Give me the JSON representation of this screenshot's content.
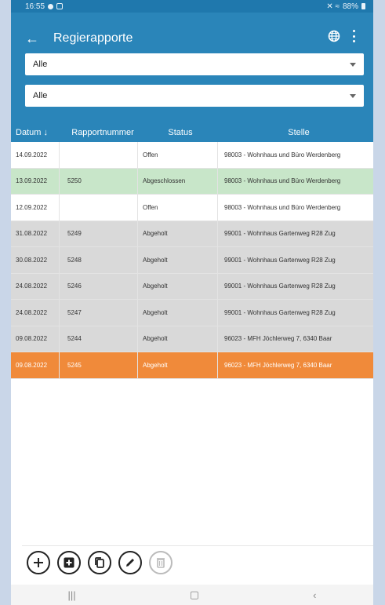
{
  "status_bar": {
    "time": "16:55",
    "battery": "88%"
  },
  "app_bar": {
    "title": "Regierapporte",
    "back_icon": "arrow-left-icon",
    "globe_icon": "globe-icon",
    "menu_icon": "more-vert-icon"
  },
  "filters": [
    {
      "value": "Alle"
    },
    {
      "value": "Alle"
    }
  ],
  "table": {
    "headers": {
      "date": "Datum ↓",
      "number": "Rapportnummer",
      "status": "Status",
      "stelle": "Stelle"
    },
    "rows": [
      {
        "date": "14.09.2022",
        "number": "",
        "status": "Offen",
        "stelle": "98003 - Wohnhaus und Büro Werdenberg",
        "color": "white"
      },
      {
        "date": "13.09.2022",
        "number": "5250",
        "status": "Abgeschlossen",
        "stelle": "98003 - Wohnhaus und Büro Werdenberg",
        "color": "green"
      },
      {
        "date": "12.09.2022",
        "number": "",
        "status": "Offen",
        "stelle": "98003 - Wohnhaus und Büro Werdenberg",
        "color": "white"
      },
      {
        "date": "31.08.2022",
        "number": "5249",
        "status": "Abgeholt",
        "stelle": "99001 - Wohnhaus Gartenweg R28 Zug",
        "color": "grey"
      },
      {
        "date": "30.08.2022",
        "number": "5248",
        "status": "Abgeholt",
        "stelle": "99001 - Wohnhaus Gartenweg R28 Zug",
        "color": "grey"
      },
      {
        "date": "24.08.2022",
        "number": "5246",
        "status": "Abgeholt",
        "stelle": "99001 - Wohnhaus Gartenweg R28 Zug",
        "color": "grey"
      },
      {
        "date": "24.08.2022",
        "number": "5247",
        "status": "Abgeholt",
        "stelle": "99001 - Wohnhaus Gartenweg R28 Zug",
        "color": "grey"
      },
      {
        "date": "09.08.2022",
        "number": "5244",
        "status": "Abgeholt",
        "stelle": "96023 - MFH Jöchlerweg 7, 6340 Baar",
        "color": "grey"
      },
      {
        "date": "09.08.2022",
        "number": "5245",
        "status": "Abgeholt",
        "stelle": "96023 - MFH Jöchlerweg 7, 6340 Baar",
        "color": "orange"
      }
    ]
  },
  "toolbar": [
    "add-icon",
    "add-box-icon",
    "copy-icon",
    "edit-icon",
    "delete-icon"
  ],
  "colors": {
    "primary": "#2a85b9",
    "green_row": "#c8e6c9",
    "grey_row": "#d9d9d9",
    "orange_row": "#f08a3a"
  }
}
